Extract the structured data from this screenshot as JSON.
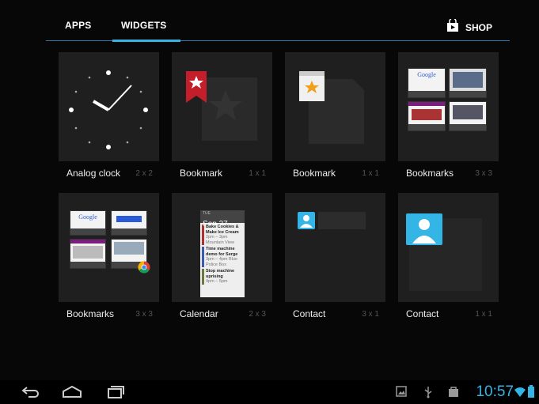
{
  "tabs": [
    {
      "label": "APPS"
    },
    {
      "label": "WIDGETS"
    }
  ],
  "shop_label": "SHOP",
  "widgets": [
    {
      "name": "Analog clock",
      "size": "2 x 2"
    },
    {
      "name": "Bookmark",
      "size": "1 x 1"
    },
    {
      "name": "Bookmark",
      "size": "1 x 1"
    },
    {
      "name": "Bookmarks",
      "size": "3 x 3"
    },
    {
      "name": "Bookmarks",
      "size": "3 x 3"
    },
    {
      "name": "Calendar",
      "size": "2 x 3"
    },
    {
      "name": "Contact",
      "size": "3 x 1"
    },
    {
      "name": "Contact",
      "size": "1 x 1"
    }
  ],
  "calendar_preview": {
    "weekday": "TUE",
    "date": "Sep 27",
    "events": [
      {
        "title": "Bake Cookies & Make Ice Cream",
        "detail": "2pm – 3pm Mountain View",
        "color": "#b03030"
      },
      {
        "title": "Time machine demo for Serge",
        "detail": "3pm – 4pm Blue Police Box",
        "color": "#3b5bb0"
      },
      {
        "title": "Stop machine uprising",
        "detail": "4pm – 5pm",
        "color": "#6a7a3a"
      }
    ]
  },
  "status": {
    "time": "10:57"
  },
  "colors": {
    "accent": "#33b5e5",
    "tile": "#1f1f1f",
    "background": "#070707"
  }
}
